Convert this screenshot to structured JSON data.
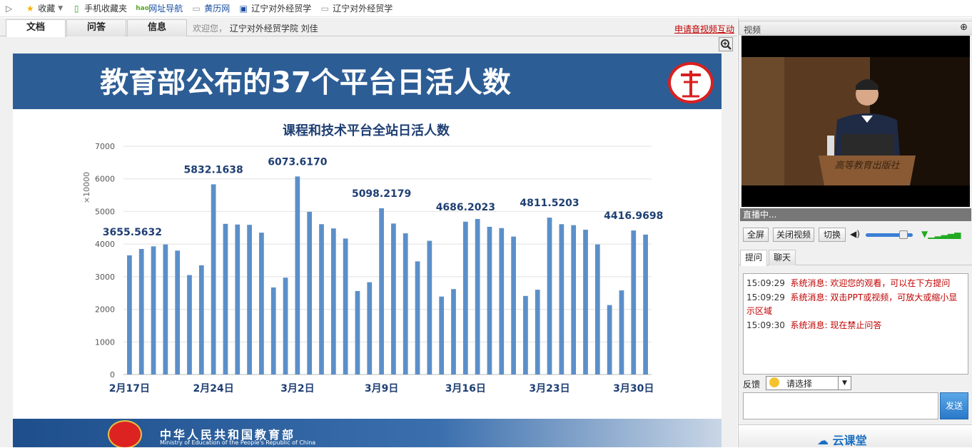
{
  "bookmarks": [
    {
      "label": "收藏",
      "icon": "star-icon"
    },
    {
      "label": "手机收藏夹",
      "icon": "phone-icon"
    },
    {
      "label": "网址导航",
      "icon": "hao-icon"
    },
    {
      "label": "黄历网",
      "icon": "page-icon"
    },
    {
      "label": "辽宁对外经贸学",
      "icon": "site-icon"
    },
    {
      "label": "辽宁对外经贸学",
      "icon": "page-icon"
    }
  ],
  "tabs": [
    {
      "label": "文档"
    },
    {
      "label": "问答"
    },
    {
      "label": "信息"
    }
  ],
  "welcome": {
    "prefix": "欢迎您，",
    "user": "辽宁对外经贸学院 刘佳"
  },
  "apply_link": "申请音视频互动",
  "slide": {
    "title": "教育部公布的37个平台日活人数",
    "footer_cn": "中华人民共和国教育部",
    "footer_en": "Ministry of Education of the People's Republic of China"
  },
  "chart_data": {
    "type": "bar",
    "title": "课程和技术平台全站日活人数",
    "ylabel": "×10000",
    "ylim": [
      0,
      7000
    ],
    "yticks": [
      0,
      1000,
      2000,
      3000,
      4000,
      5000,
      6000,
      7000
    ],
    "x_tick_labels": [
      "2月17日",
      "2月24日",
      "3月2日",
      "3月9日",
      "3月16日",
      "3月23日",
      "3月30日"
    ],
    "x_tick_index": [
      0,
      7,
      14,
      21,
      28,
      35,
      42
    ],
    "values": [
      3655.5632,
      3850,
      3930,
      3990,
      3800,
      3050,
      3350,
      5832.1638,
      4620,
      4600,
      4590,
      4350,
      2670,
      2970,
      6073.617,
      4990,
      4610,
      4480,
      4170,
      2560,
      2830,
      5098.2179,
      4630,
      4330,
      3470,
      4100,
      2390,
      2620,
      4686.2023,
      4770,
      4530,
      4490,
      4230,
      2410,
      2600,
      4811.5203,
      4610,
      4580,
      4440,
      3990,
      2130,
      2580,
      4416.9698,
      4290
    ],
    "annotations": [
      {
        "index": 0,
        "text": "3655.5632"
      },
      {
        "index": 7,
        "text": "5832.1638"
      },
      {
        "index": 14,
        "text": "6073.6170"
      },
      {
        "index": 21,
        "text": "5098.2179"
      },
      {
        "index": 28,
        "text": "4686.2023"
      },
      {
        "index": 35,
        "text": "4811.5203"
      },
      {
        "index": 42,
        "text": "4416.9698"
      }
    ],
    "bar_color": "#5b8fc9",
    "grid": true
  },
  "video": {
    "label": "视频",
    "status": "直播中..."
  },
  "video_buttons": {
    "fullscreen": "全屏",
    "close_video": "关闭视频",
    "switch": "切换"
  },
  "volume": 0.8,
  "subtabs": [
    {
      "label": "提问"
    },
    {
      "label": "聊天"
    }
  ],
  "messages": [
    {
      "time": "15:09:29",
      "text": "系统消息: 欢迎您的观看，可以在下方提问"
    },
    {
      "time": "15:09:29",
      "text": "系统消息: 双击PPT或视频，可放大或缩小显示区域"
    },
    {
      "time": "15:09:30",
      "text": "系统消息: 现在禁止问答"
    }
  ],
  "feedback": {
    "label": "反馈",
    "selected": "请选择"
  },
  "send": "发送",
  "brand": "云课堂"
}
